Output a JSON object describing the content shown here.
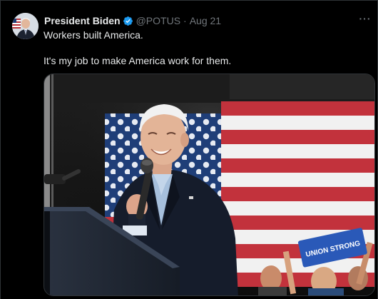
{
  "tweet": {
    "author_name": "President Biden",
    "handle": "@POTUS",
    "separator": "·",
    "date": "Aug 21",
    "more_label": "···",
    "text_line1": "Workers built America.",
    "text_line2": "It's my job to make America work for them."
  },
  "media": {
    "alt": "Photo of President Biden speaking at a podium in front of an American flag",
    "sign_text": "UNION STRONG"
  },
  "colors": {
    "background": "#000000",
    "text_primary": "#e7e9ea",
    "text_secondary": "#71767b",
    "verified_blue": "#1d9bf0",
    "border": "#2f3336"
  },
  "icons": {
    "verified": "verified-badge-icon",
    "more": "more-options-icon"
  }
}
